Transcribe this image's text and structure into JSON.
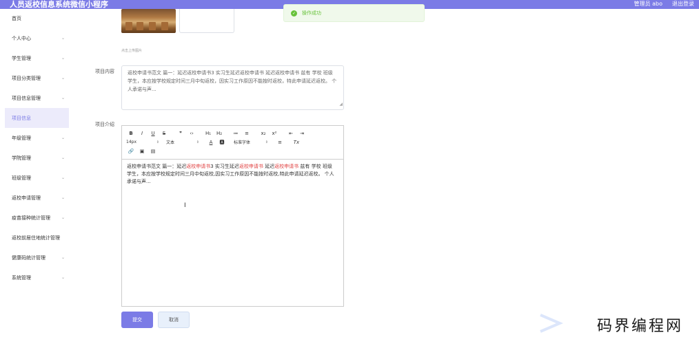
{
  "header": {
    "title": "人员返校信息系统微信小程序",
    "user": "管理员 abo",
    "logout": "退出登录"
  },
  "toast": {
    "message": "操作成功",
    "color": "#67c23a"
  },
  "sidebar": {
    "items": [
      {
        "label": "首页",
        "has_children": false
      },
      {
        "label": "个人中心",
        "has_children": true
      },
      {
        "label": "学生管理",
        "has_children": true
      },
      {
        "label": "项目分类管理",
        "has_children": true
      },
      {
        "label": "项目信息管理",
        "has_children": true
      },
      {
        "label": "项目信息",
        "has_children": false,
        "active": true
      },
      {
        "label": "年级管理",
        "has_children": true
      },
      {
        "label": "学院管理",
        "has_children": true
      },
      {
        "label": "班级管理",
        "has_children": true
      },
      {
        "label": "返校申请管理",
        "has_children": true
      },
      {
        "label": "疫苗接种统计管理",
        "has_children": true
      },
      {
        "label": "返校前居住地统计管理",
        "has_children": false
      },
      {
        "label": "健康码统计管理",
        "has_children": true
      },
      {
        "label": "系统管理",
        "has_children": true
      }
    ]
  },
  "form": {
    "upload_tip": "点击上传图片",
    "content_label": "项目内容",
    "content_value": "返校申请书范文 篇一：延迟返校申请书3 实习生延迟返校申请书 延迟返校申请书 兹有 学校 班级 学生，本应按学校规定时间三月中旬返校，因实习工作原因不能按时返校，特此申请延迟返校。 个人承诺与声...",
    "intro_label": "项目介绍",
    "toolbar": {
      "row1": [
        "B",
        "I",
        "U",
        "S",
        "❞",
        "‹›",
        "H₁",
        "H₂",
        "≔",
        "≡",
        "x₂",
        "x²",
        "⇤",
        "⇥"
      ],
      "font_size": "14px",
      "text_style": "文本",
      "font_family": "标准字体",
      "row2_icons": [
        "A",
        "🅰",
        "≡",
        "Tx"
      ],
      "row3": [
        "🔗",
        "▣",
        "▤"
      ]
    },
    "intro_body": {
      "p1": "返校申请书范文 篇一：延迟",
      "h1": "返校申请书",
      "p2": "3 实习生延迟",
      "h2": "返校申请书",
      "p3": " 延迟",
      "h3": "返校申请书",
      "p4": " 兹有 学校 班级 学生，本应按学校规定时间三月中旬返校,因实习工作原因不能按时返校,特此申请延迟返校。 个人承诺与声..."
    },
    "submit": "提交",
    "cancel": "取消"
  },
  "accent_color": "#7b7be6",
  "watermark": "码界编程网"
}
